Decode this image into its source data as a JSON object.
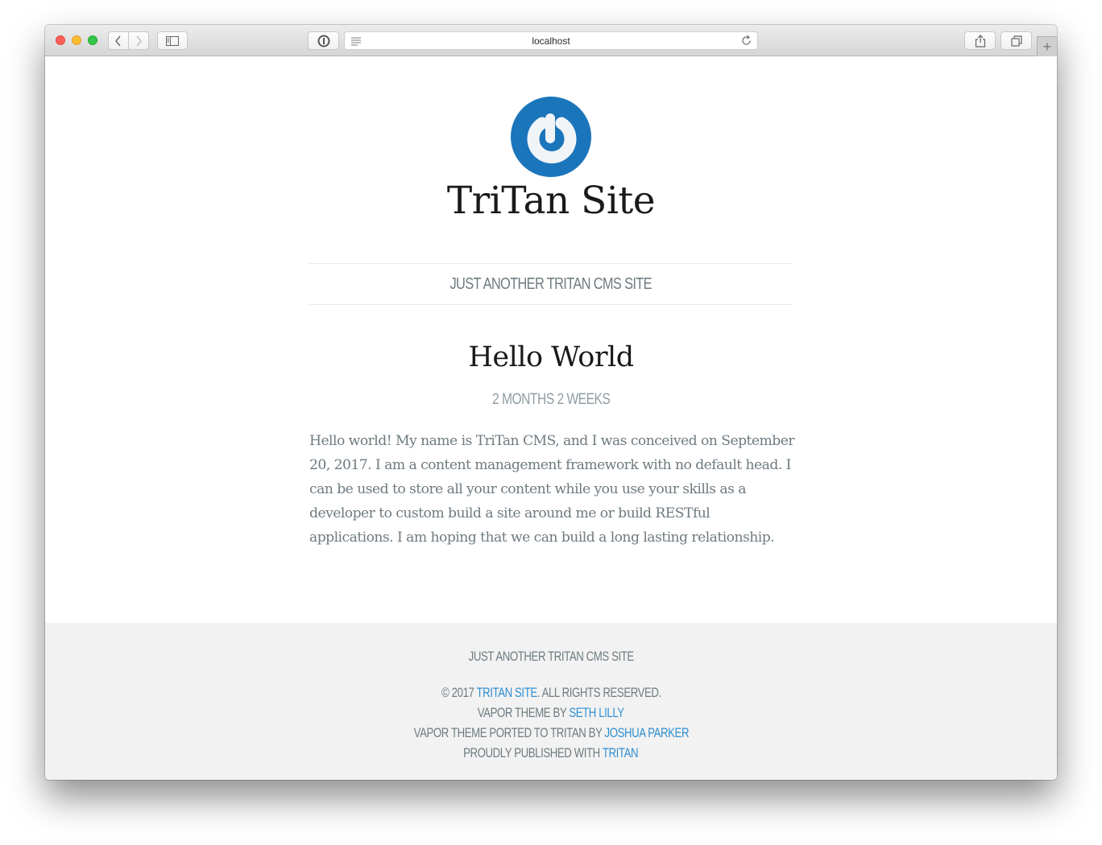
{
  "browser": {
    "url": "localhost",
    "icons": {
      "back": "chevron-left-icon",
      "forward": "chevron-right-icon",
      "sidebar": "sidebar-icon",
      "password": "1password-icon",
      "reader": "reader-icon",
      "reload": "reload-icon",
      "share": "share-icon",
      "tabs": "tabs-icon",
      "new_tab": "plus-icon"
    },
    "new_tab_glyph": "+"
  },
  "header": {
    "site_title": "TriTan Site",
    "tagline": "JUST ANOTHER TRITAN CMS SITE",
    "logo_color": "#1b75bb"
  },
  "post": {
    "title": "Hello World",
    "meta": "2 MONTHS 2 WEEKS",
    "body": "Hello world! My name is TriTan CMS, and I was conceived on September 20, 2017. I am a content management framework with no default head. I can be used to store all your content while you use your skills as a developer to custom build a site around me or build RESTful applications. I am hoping that we can build a long lasting relationship."
  },
  "footer": {
    "tagline": "JUST ANOTHER TRITAN CMS SITE",
    "copyright_prefix": "© 2017 ",
    "copyright_link": "TRITAN SITE",
    "copyright_suffix": ". ALL RIGHTS RESERVED.",
    "theme_prefix": "VAPOR THEME BY ",
    "theme_link": "SETH LILLY",
    "ported_prefix": "VAPOR THEME PORTED TO TRITAN BY ",
    "ported_link": "JOSHUA PARKER",
    "published_prefix": "PROUDLY PUBLISHED WITH ",
    "published_link": "TRITAN",
    "link_color": "#2f8fd2"
  }
}
